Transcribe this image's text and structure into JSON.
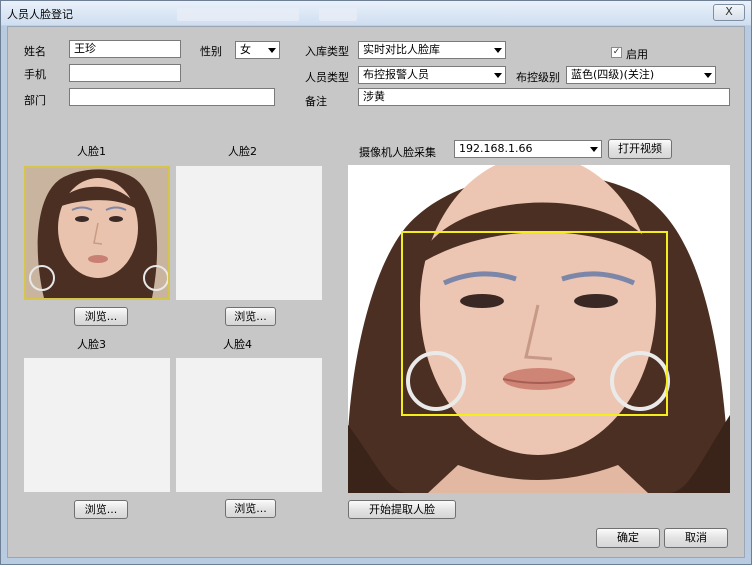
{
  "window": {
    "title": "人员人脸登记",
    "close_label": "X"
  },
  "form": {
    "name_label": "姓名",
    "name_value": "王珍",
    "gender_label": "性别",
    "gender_value": "女",
    "phone_label": "手机",
    "phone_value": "",
    "dept_label": "部门",
    "dept_value": "",
    "store_type_label": "入库类型",
    "store_type_value": "实时对比人脸库",
    "enable_label": "启用",
    "enable_checked": true,
    "person_type_label": "人员类型",
    "person_type_value": "布控报警人员",
    "control_level_label": "布控级别",
    "control_level_value": "蓝色(四级)(关注)",
    "remark_label": "备注",
    "remark_value": "涉黄"
  },
  "faces": [
    {
      "label": "人脸1",
      "browse": "浏览..."
    },
    {
      "label": "人脸2",
      "browse": "浏览..."
    },
    {
      "label": "人脸3",
      "browse": "浏览..."
    },
    {
      "label": "人脸4",
      "browse": "浏览..."
    }
  ],
  "camera": {
    "label": "摄像机人脸采集",
    "ip_value": "192.168.1.66",
    "open_video": "打开视频",
    "start_extract": "开始提取人脸"
  },
  "footer": {
    "ok": "确定",
    "cancel": "取消"
  },
  "colors": {
    "client_bg": "#c7c7c7",
    "detect_box": "#f4ee1c"
  }
}
